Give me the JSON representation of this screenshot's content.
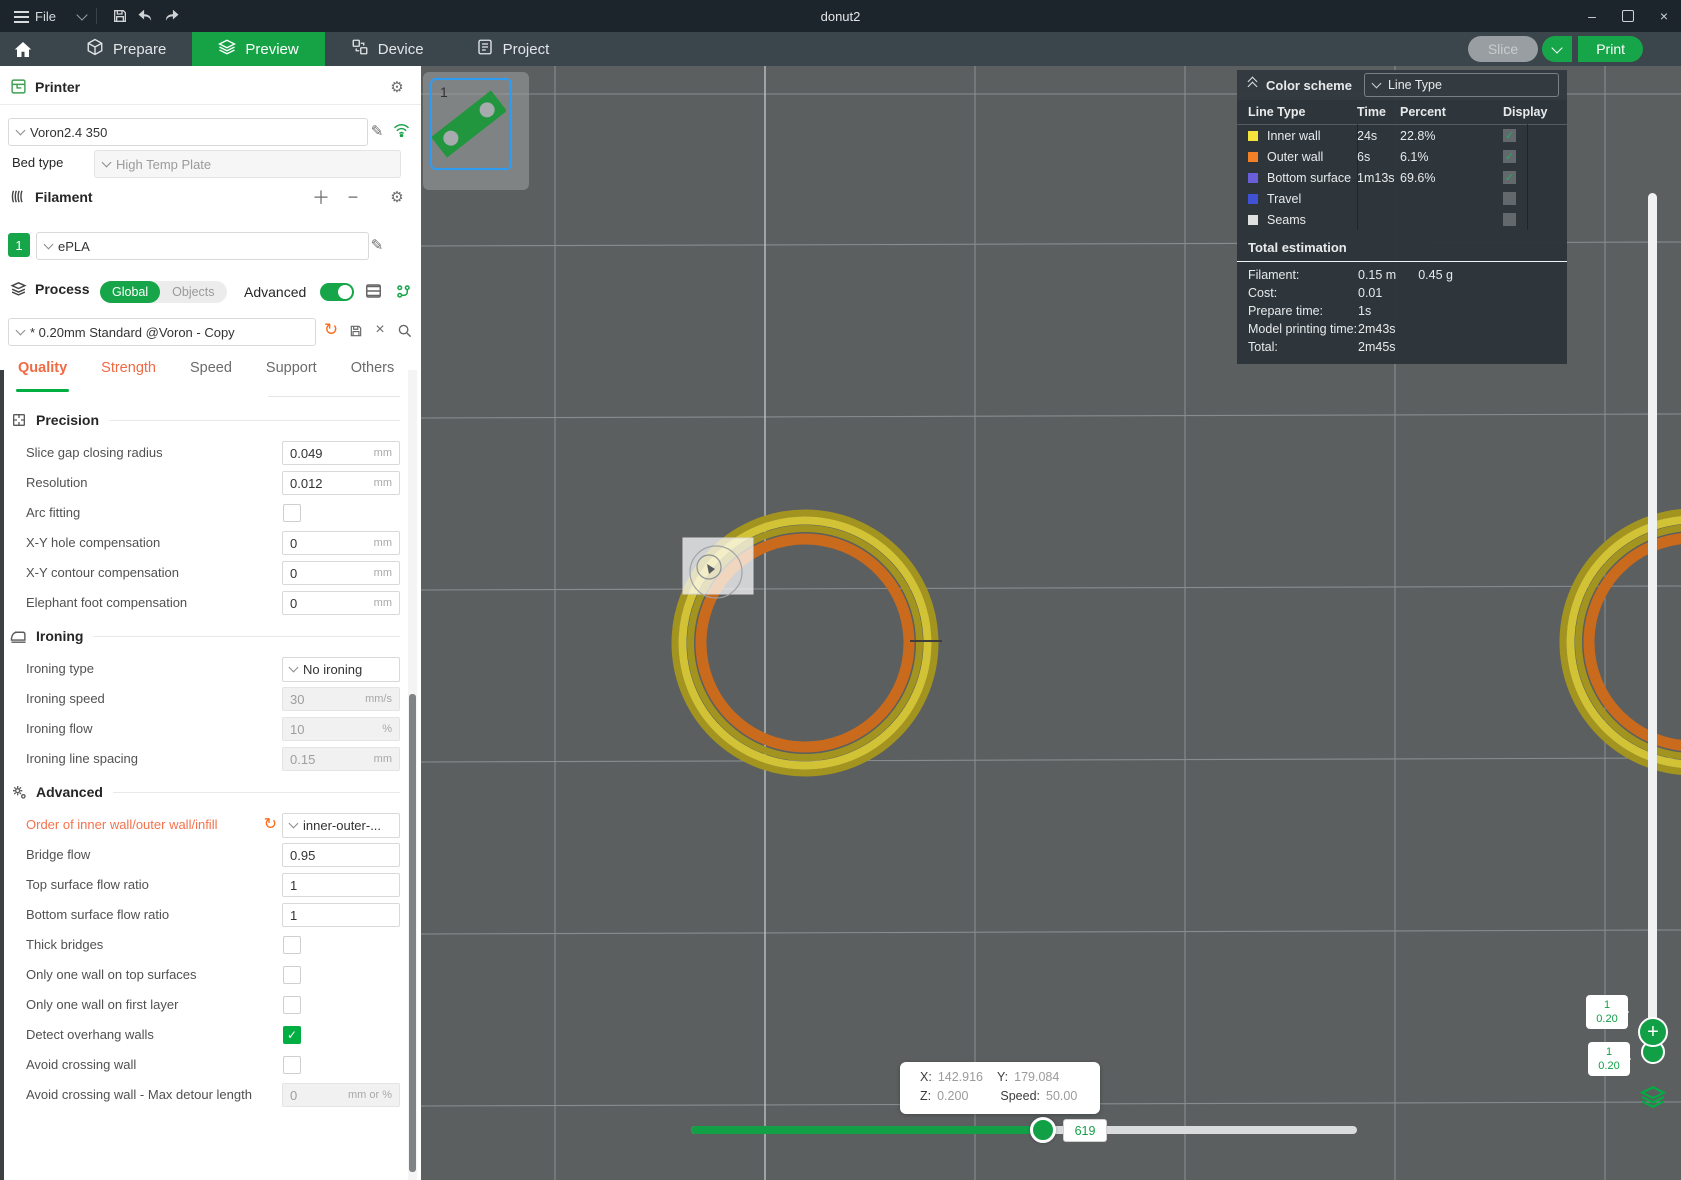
{
  "titlebar": {
    "menu_label": "File",
    "title": "donut2"
  },
  "navbar": {
    "tabs": [
      {
        "label": "Prepare",
        "icon": "cube-icon",
        "active": false
      },
      {
        "label": "Preview",
        "icon": "layers-icon",
        "active": true
      },
      {
        "label": "Device",
        "icon": "device-icon",
        "active": false
      },
      {
        "label": "Project",
        "icon": "project-icon",
        "active": false
      }
    ]
  },
  "top_actions": {
    "slice_label": "Slice",
    "print_label": "Print"
  },
  "printer": {
    "title": "Printer",
    "preset": "Voron2.4 350",
    "bed_type_label": "Bed type",
    "bed_type_value": "High Temp Plate"
  },
  "filament": {
    "title": "Filament",
    "slot": "1",
    "preset": "ePLA"
  },
  "process": {
    "title": "Process",
    "scope_global": "Global",
    "scope_objects": "Objects",
    "advanced_label": "Advanced",
    "preset": "* 0.20mm Standard @Voron - Copy",
    "tabs": [
      {
        "label": "Quality",
        "active": true,
        "modified": true
      },
      {
        "label": "Strength",
        "active": false,
        "modified": true
      },
      {
        "label": "Speed",
        "active": false,
        "modified": false
      },
      {
        "label": "Support",
        "active": false,
        "modified": false
      },
      {
        "label": "Others",
        "active": false,
        "modified": false
      }
    ],
    "sections": [
      {
        "title": "Precision",
        "icon": "precision-icon",
        "rows": [
          {
            "label": "Slice gap closing radius",
            "type": "input",
            "value": "0.049",
            "unit": "mm"
          },
          {
            "label": "Resolution",
            "type": "input",
            "value": "0.012",
            "unit": "mm"
          },
          {
            "label": "Arc fitting",
            "type": "checkbox",
            "checked": false
          },
          {
            "label": "X-Y hole compensation",
            "type": "input",
            "value": "0",
            "unit": "mm"
          },
          {
            "label": "X-Y contour compensation",
            "type": "input",
            "value": "0",
            "unit": "mm"
          },
          {
            "label": "Elephant foot compensation",
            "type": "input",
            "value": "0",
            "unit": "mm"
          }
        ]
      },
      {
        "title": "Ironing",
        "icon": "ironing-icon",
        "rows": [
          {
            "label": "Ironing type",
            "type": "select",
            "value": "No ironing"
          },
          {
            "label": "Ironing speed",
            "type": "input",
            "value": "30",
            "unit": "mm/s",
            "disabled": true
          },
          {
            "label": "Ironing flow",
            "type": "input",
            "value": "10",
            "unit": "%",
            "disabled": true
          },
          {
            "label": "Ironing line spacing",
            "type": "input",
            "value": "0.15",
            "unit": "mm",
            "disabled": true
          }
        ]
      },
      {
        "title": "Advanced",
        "icon": "advanced-icon",
        "rows": [
          {
            "label": "Order of inner wall/outer wall/infill",
            "type": "select",
            "value": "inner-outer-...",
            "modified": true
          },
          {
            "label": "Bridge flow",
            "type": "input",
            "value": "0.95",
            "unit": ""
          },
          {
            "label": "Top surface flow ratio",
            "type": "input",
            "value": "1",
            "unit": ""
          },
          {
            "label": "Bottom surface flow ratio",
            "type": "input",
            "value": "1",
            "unit": ""
          },
          {
            "label": "Thick bridges",
            "type": "checkbox",
            "checked": false
          },
          {
            "label": "Only one wall on top surfaces",
            "type": "checkbox",
            "checked": false
          },
          {
            "label": "Only one wall on first layer",
            "type": "checkbox",
            "checked": false
          },
          {
            "label": "Detect overhang walls",
            "type": "checkbox",
            "checked": true
          },
          {
            "label": "Avoid crossing wall",
            "type": "checkbox",
            "checked": false
          },
          {
            "label": "Avoid crossing wall - Max detour length",
            "type": "input",
            "value": "0",
            "unit": "mm or %",
            "disabled": true
          }
        ]
      }
    ]
  },
  "legend": {
    "header_label": "Color scheme",
    "view_mode": "Line Type",
    "columns": [
      "Line Type",
      "Time",
      "Percent",
      "Display"
    ],
    "rows": [
      {
        "type": "Inner wall",
        "swatch": "#f5e23c",
        "time": "24s",
        "percent": "22.8%",
        "display": true
      },
      {
        "type": "Outer wall",
        "swatch": "#f28026",
        "time": "6s",
        "percent": "6.1%",
        "display": true
      },
      {
        "type": "Bottom surface",
        "swatch": "#6a5fd8",
        "time": "1m13s",
        "percent": "69.6%",
        "display": true
      },
      {
        "type": "Travel",
        "swatch": "#3f51d4",
        "time": "",
        "percent": "",
        "display": false
      },
      {
        "type": "Seams",
        "swatch": "#e0e0e0",
        "time": "",
        "percent": "",
        "display": false
      }
    ],
    "estimation": {
      "title": "Total estimation",
      "rows": [
        {
          "label": "Filament:",
          "values": [
            "0.15 m",
            "0.45 g"
          ]
        },
        {
          "label": "Cost:",
          "values": [
            "0.01"
          ]
        },
        {
          "label": "Prepare time:",
          "values": [
            "1s"
          ]
        },
        {
          "label": "Model printing time:",
          "values": [
            "2m43s"
          ]
        },
        {
          "label": "Total:",
          "values": [
            "2m45s"
          ]
        }
      ]
    }
  },
  "plate": {
    "number": "1"
  },
  "layer_slider": {
    "top_badge": [
      "1",
      "0.20"
    ],
    "bottom_badge": [
      "1",
      "0.20"
    ]
  },
  "move_slider": {
    "value": "619",
    "tooltip": {
      "x_label": "X:",
      "x_value": "142.916",
      "y_label": "Y:",
      "y_value": "179.084",
      "z_label": "Z:",
      "z_value": "0.200",
      "speed_label": "Speed:",
      "speed_value": "50.00"
    }
  },
  "colors": {
    "accent_green": "#00ae42",
    "modified_orange": "#f4724d",
    "inner_wall": "#f5e23c",
    "outer_wall": "#f28026",
    "bottom_surface": "#6a5fd8",
    "travel": "#3f51d4",
    "seams": "#e0e0e0"
  }
}
